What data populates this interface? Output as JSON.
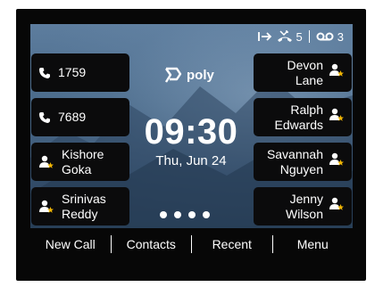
{
  "status": {
    "forward_icon": "call-forward-icon",
    "missed_icon": "missed-call-icon",
    "missed_count": "5",
    "voicemail_icon": "voicemail-icon",
    "voicemail_count": "3"
  },
  "logo": {
    "text": "poly"
  },
  "clock": {
    "time": "09:30",
    "date": "Thu, Jun 24"
  },
  "left_keys": [
    {
      "label": "1759",
      "icon": "phone-icon"
    },
    {
      "label": "7689",
      "icon": "phone-icon"
    },
    {
      "label": "Kishore\nGoka",
      "icon": "contact-star-icon"
    },
    {
      "label": "Srinivas\nReddy",
      "icon": "contact-star-icon"
    }
  ],
  "right_keys": [
    {
      "label": "Devon\nLane",
      "icon": "contact-star-icon"
    },
    {
      "label": "Ralph\nEdwards",
      "icon": "contact-star-icon"
    },
    {
      "label": "Savannah\nNguyen",
      "icon": "contact-star-icon"
    },
    {
      "label": "Jenny\nWilson",
      "icon": "contact-star-icon"
    }
  ],
  "pages": {
    "count": 4
  },
  "softkeys": [
    "New Call",
    "Contacts",
    "Recent",
    "Menu"
  ],
  "colors": {
    "screen": "#4a6a8a",
    "key": "#0b0b0c",
    "star": "#f2b705"
  }
}
